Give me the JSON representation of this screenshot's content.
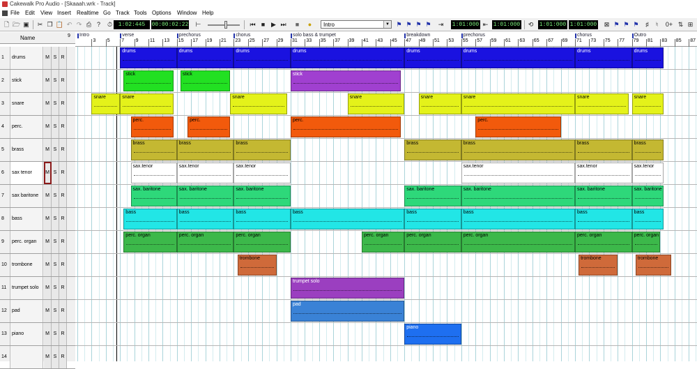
{
  "window": {
    "title": "Cakewalk Pro Audio - [Skaaah.wrk - Track]"
  },
  "menu": [
    "File",
    "Edit",
    "View",
    "Insert",
    "Realtime",
    "Go",
    "Track",
    "Tools",
    "Options",
    "Window",
    "Help"
  ],
  "toolbar": {
    "now_time_mbt": "1:02:445",
    "now_time_smpte": "00:00:02:22",
    "marker": "Intro",
    "from_time": "1:01:000",
    "thru_time": "1:01:000",
    "loop_from": "1:01:000",
    "loop_thru": "1:01:000"
  },
  "header": {
    "name_col": "Name",
    "col9": "9"
  },
  "ruler": {
    "markers": [
      {
        "label": "Intro",
        "measure": 1
      },
      {
        "label": "verse",
        "measure": 7
      },
      {
        "label": "prechorus",
        "measure": 15
      },
      {
        "label": "chorus",
        "measure": 23
      },
      {
        "label": "solo bass & trumpet",
        "measure": 31
      },
      {
        "label": "breakdown",
        "measure": 47
      },
      {
        "label": "prechorus",
        "measure": 55
      },
      {
        "label": "chorus",
        "measure": 71
      },
      {
        "label": "Outro",
        "measure": 79
      }
    ],
    "ticks": [
      "3",
      "5",
      "7",
      "9",
      "11",
      "13",
      "15",
      "17",
      "19",
      "21",
      "23",
      "25",
      "27",
      "29",
      "31",
      "33",
      "35",
      "37",
      "39",
      "41",
      "43",
      "45",
      "47",
      "49",
      "51",
      "53",
      "55",
      "57",
      "59",
      "61",
      "63",
      "65",
      "67",
      "69",
      "71",
      "73",
      "75",
      "77",
      "79",
      "81",
      "83",
      "85",
      "87"
    ]
  },
  "tracks": [
    {
      "num": "1",
      "name": "drums"
    },
    {
      "num": "2",
      "name": "stick"
    },
    {
      "num": "3",
      "name": "snare"
    },
    {
      "num": "4",
      "name": "perc."
    },
    {
      "num": "5",
      "name": "brass"
    },
    {
      "num": "6",
      "name": "sax tenor",
      "selected": true
    },
    {
      "num": "7",
      "name": "sax baritone"
    },
    {
      "num": "8",
      "name": "bass"
    },
    {
      "num": "9",
      "name": "perc. organ"
    },
    {
      "num": "10",
      "name": "trombone"
    },
    {
      "num": "11",
      "name": "trumpet solo"
    },
    {
      "num": "12",
      "name": "pad"
    },
    {
      "num": "13",
      "name": "piano"
    },
    {
      "num": "14",
      "name": ""
    }
  ],
  "track_buttons": {
    "mute": "M",
    "solo": "S",
    "record": "R"
  },
  "clips": [
    {
      "track": 0,
      "label": "drums",
      "start": 7,
      "end": 15,
      "color": "#1a12e0",
      "text_color": "#fff"
    },
    {
      "track": 0,
      "label": "drums",
      "start": 15,
      "end": 23,
      "color": "#1a12e0",
      "text_color": "#fff"
    },
    {
      "track": 0,
      "label": "drums",
      "start": 23,
      "end": 31,
      "color": "#1a12e0",
      "text_color": "#fff"
    },
    {
      "track": 0,
      "label": "drums",
      "start": 31,
      "end": 47,
      "color": "#1a12e0",
      "text_color": "#fff"
    },
    {
      "track": 0,
      "label": "drums",
      "start": 47,
      "end": 55,
      "color": "#1a12e0",
      "text_color": "#fff"
    },
    {
      "track": 0,
      "label": "drums",
      "start": 55,
      "end": 71,
      "color": "#1a12e0",
      "text_color": "#fff"
    },
    {
      "track": 0,
      "label": "drums",
      "start": 71,
      "end": 79,
      "color": "#1a12e0",
      "text_color": "#fff"
    },
    {
      "track": 0,
      "label": "drums",
      "start": 79,
      "end": 83.5,
      "color": "#1a12e0",
      "text_color": "#fff"
    },
    {
      "track": 1,
      "label": "stick",
      "start": 7.5,
      "end": 14.5,
      "color": "#22e022",
      "text_color": "#000"
    },
    {
      "track": 1,
      "label": "stick",
      "start": 15.5,
      "end": 22.5,
      "color": "#22e022",
      "text_color": "#000"
    },
    {
      "track": 1,
      "label": "stick",
      "start": 31,
      "end": 46.5,
      "color": "#a040d0",
      "text_color": "#fff"
    },
    {
      "track": 2,
      "label": "snare",
      "start": 3,
      "end": 7,
      "color": "#e4f21a",
      "text_color": "#000"
    },
    {
      "track": 2,
      "label": "snare",
      "start": 7,
      "end": 14.5,
      "color": "#e4f21a",
      "text_color": "#000"
    },
    {
      "track": 2,
      "label": "snare",
      "start": 22.5,
      "end": 30.5,
      "color": "#e4f21a",
      "text_color": "#000"
    },
    {
      "track": 2,
      "label": "snare",
      "start": 39,
      "end": 47,
      "color": "#e4f21a",
      "text_color": "#000"
    },
    {
      "track": 2,
      "label": "snare",
      "start": 49,
      "end": 55,
      "color": "#e4f21a",
      "text_color": "#000"
    },
    {
      "track": 2,
      "label": "snare",
      "start": 55,
      "end": 71,
      "color": "#e4f21a",
      "text_color": "#000"
    },
    {
      "track": 2,
      "label": "snare",
      "start": 71,
      "end": 78.5,
      "color": "#e4f21a",
      "text_color": "#000"
    },
    {
      "track": 2,
      "label": "snare",
      "start": 79,
      "end": 83.5,
      "color": "#e4f21a",
      "text_color": "#000"
    },
    {
      "track": 3,
      "label": "perc.",
      "start": 8.5,
      "end": 14.5,
      "color": "#f25a0c",
      "text_color": "#000"
    },
    {
      "track": 3,
      "label": "perc.",
      "start": 16.5,
      "end": 22.5,
      "color": "#f25a0c",
      "text_color": "#000"
    },
    {
      "track": 3,
      "label": "perc.",
      "start": 31,
      "end": 46.5,
      "color": "#f25a0c",
      "text_color": "#000"
    },
    {
      "track": 3,
      "label": "perc.",
      "start": 57,
      "end": 69,
      "color": "#f25a0c",
      "text_color": "#000"
    },
    {
      "track": 4,
      "label": "brass",
      "start": 8.5,
      "end": 15,
      "color": "#c4b832",
      "text_color": "#000"
    },
    {
      "track": 4,
      "label": "brass",
      "start": 15,
      "end": 23,
      "color": "#c4b832",
      "text_color": "#000"
    },
    {
      "track": 4,
      "label": "brass",
      "start": 23,
      "end": 31,
      "color": "#c4b832",
      "text_color": "#000"
    },
    {
      "track": 4,
      "label": "brass",
      "start": 47,
      "end": 55,
      "color": "#c4b832",
      "text_color": "#000"
    },
    {
      "track": 4,
      "label": "brass",
      "start": 55,
      "end": 71,
      "color": "#c4b832",
      "text_color": "#000"
    },
    {
      "track": 4,
      "label": "brass",
      "start": 71,
      "end": 79,
      "color": "#c4b832",
      "text_color": "#000"
    },
    {
      "track": 4,
      "label": "brass",
      "start": 79,
      "end": 83.5,
      "color": "#c4b832",
      "text_color": "#000"
    },
    {
      "track": 5,
      "label": "sax.tenor",
      "start": 8.5,
      "end": 15,
      "color": "#ffffff",
      "text_color": "#000"
    },
    {
      "track": 5,
      "label": "sax.tenor",
      "start": 15,
      "end": 23,
      "color": "#ffffff",
      "text_color": "#000"
    },
    {
      "track": 5,
      "label": "sax.tenor",
      "start": 23,
      "end": 31,
      "color": "#ffffff",
      "text_color": "#000"
    },
    {
      "track": 5,
      "label": "sax.tenor",
      "start": 55,
      "end": 71,
      "color": "#ffffff",
      "text_color": "#000"
    },
    {
      "track": 5,
      "label": "sax.tenor",
      "start": 71,
      "end": 79,
      "color": "#ffffff",
      "text_color": "#000"
    },
    {
      "track": 5,
      "label": "sax.tenor",
      "start": 79,
      "end": 83.5,
      "color": "#ffffff",
      "text_color": "#000"
    },
    {
      "track": 6,
      "label": "sax. baritone",
      "start": 8.5,
      "end": 15,
      "color": "#2ed87a",
      "text_color": "#000"
    },
    {
      "track": 6,
      "label": "sax. baritone",
      "start": 15,
      "end": 23,
      "color": "#2ed87a",
      "text_color": "#000"
    },
    {
      "track": 6,
      "label": "sax. baritone",
      "start": 23,
      "end": 31,
      "color": "#2ed87a",
      "text_color": "#000"
    },
    {
      "track": 6,
      "label": "sax. baritone",
      "start": 47,
      "end": 55,
      "color": "#2ed87a",
      "text_color": "#000"
    },
    {
      "track": 6,
      "label": "sax. baritone",
      "start": 55,
      "end": 71,
      "color": "#2ed87a",
      "text_color": "#000"
    },
    {
      "track": 6,
      "label": "sax. baritone",
      "start": 71,
      "end": 79,
      "color": "#2ed87a",
      "text_color": "#000"
    },
    {
      "track": 6,
      "label": "sax. baritone",
      "start": 79,
      "end": 83.5,
      "color": "#2ed87a",
      "text_color": "#000"
    },
    {
      "track": 7,
      "label": "bass",
      "start": 7.5,
      "end": 15,
      "color": "#22e6e6",
      "text_color": "#000"
    },
    {
      "track": 7,
      "label": "bass",
      "start": 15,
      "end": 23,
      "color": "#22e6e6",
      "text_color": "#000"
    },
    {
      "track": 7,
      "label": "bass",
      "start": 23,
      "end": 31,
      "color": "#22e6e6",
      "text_color": "#000"
    },
    {
      "track": 7,
      "label": "bass",
      "start": 31,
      "end": 47,
      "color": "#22e6e6",
      "text_color": "#000"
    },
    {
      "track": 7,
      "label": "bass",
      "start": 47,
      "end": 55,
      "color": "#22e6e6",
      "text_color": "#000"
    },
    {
      "track": 7,
      "label": "bass",
      "start": 55,
      "end": 71,
      "color": "#22e6e6",
      "text_color": "#000"
    },
    {
      "track": 7,
      "label": "bass",
      "start": 71,
      "end": 79,
      "color": "#22e6e6",
      "text_color": "#000"
    },
    {
      "track": 7,
      "label": "bass",
      "start": 79,
      "end": 83.5,
      "color": "#22e6e6",
      "text_color": "#000"
    },
    {
      "track": 8,
      "label": "perc. organ",
      "start": 7.5,
      "end": 15,
      "color": "#3cb84a",
      "text_color": "#000"
    },
    {
      "track": 8,
      "label": "perc. organ",
      "start": 15,
      "end": 23,
      "color": "#3cb84a",
      "text_color": "#000"
    },
    {
      "track": 8,
      "label": "perc. organ",
      "start": 23,
      "end": 31,
      "color": "#3cb84a",
      "text_color": "#000"
    },
    {
      "track": 8,
      "label": "perc. organ",
      "start": 41,
      "end": 47,
      "color": "#3cb84a",
      "text_color": "#000"
    },
    {
      "track": 8,
      "label": "perc. organ",
      "start": 47,
      "end": 55,
      "color": "#3cb84a",
      "text_color": "#000"
    },
    {
      "track": 8,
      "label": "perc. organ",
      "start": 55,
      "end": 71,
      "color": "#3cb84a",
      "text_color": "#000"
    },
    {
      "track": 8,
      "label": "perc. organ",
      "start": 71,
      "end": 79,
      "color": "#3cb84a",
      "text_color": "#000"
    },
    {
      "track": 8,
      "label": "perc. organ",
      "start": 79,
      "end": 83,
      "color": "#3cb84a",
      "text_color": "#000"
    },
    {
      "track": 9,
      "label": "trombone",
      "start": 23.5,
      "end": 29,
      "color": "#cf6a3a",
      "text_color": "#000"
    },
    {
      "track": 9,
      "label": "trombone",
      "start": 71.5,
      "end": 77,
      "color": "#cf6a3a",
      "text_color": "#000"
    },
    {
      "track": 9,
      "label": "trombone",
      "start": 79.5,
      "end": 84.5,
      "color": "#cf6a3a",
      "text_color": "#000"
    },
    {
      "track": 10,
      "label": "trumpet solo",
      "start": 31,
      "end": 47,
      "color": "#9b3fc0",
      "text_color": "#fff"
    },
    {
      "track": 11,
      "label": "pad",
      "start": 31,
      "end": 47,
      "color": "#3a82d6",
      "text_color": "#fff"
    },
    {
      "track": 12,
      "label": "piano",
      "start": 47,
      "end": 55,
      "color": "#1e6ff0",
      "text_color": "#fff"
    }
  ]
}
